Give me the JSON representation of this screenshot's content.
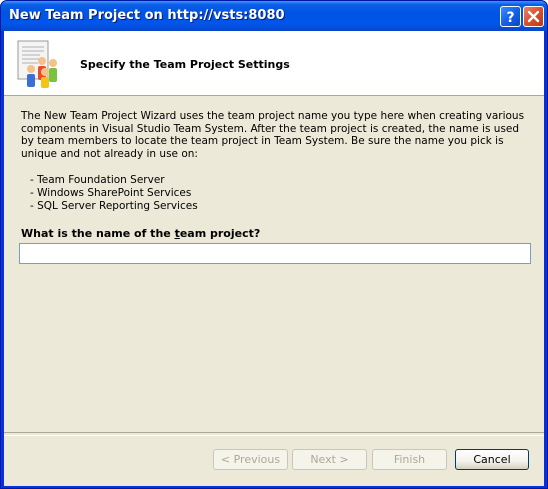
{
  "window": {
    "title": "New Team Project on http://vsts:8080",
    "help_label": "?",
    "close_label": "X"
  },
  "header": {
    "title": "Specify the Team Project Settings",
    "icon": "wizard-team-icon"
  },
  "description": "The New Team Project Wizard uses the team project name you type here when creating various components in Visual Studio Team System.  After the team project is created, the name is used by team members to locate the team project in Team System.  Be sure the name you pick is unique and not already in use on:",
  "bullets": [
    "- Team Foundation Server",
    "- Windows SharePoint Services",
    "- SQL Server Reporting Services"
  ],
  "question": {
    "before": "What is the name of the ",
    "accel": "t",
    "after": "eam project?"
  },
  "project_name": {
    "value": "",
    "placeholder": ""
  },
  "buttons": {
    "previous": "< Previous",
    "next": "Next >",
    "finish": "Finish",
    "cancel": "Cancel"
  },
  "colors": {
    "titlebar": "#0054e3",
    "client": "#ece9d8",
    "header": "#ffffff"
  }
}
